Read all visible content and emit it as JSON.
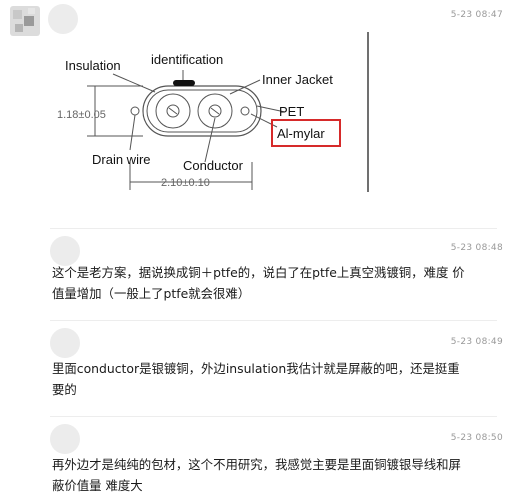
{
  "messages": [
    {
      "time": "5-23 08:47",
      "figure": {
        "labels": {
          "insulation": "Insulation",
          "identification": "identification",
          "inner_jacket": "Inner Jacket",
          "pet": "PET",
          "al_mylar": "Al-mylar",
          "drain_wire": "Drain wire",
          "conductor": "Conductor",
          "height_dim": "1.18±0.05",
          "width_dim": "2.10±0.10"
        },
        "colors": {
          "highlight": "#d62a2a",
          "line": "#555555"
        }
      }
    },
    {
      "time": "5-23 08:48",
      "text": "这个是老方案，据说换成铜＋ptfe的，说白了在ptfe上真空溅镀铜，难度 价值量增加（一般上了ptfe就会很难）"
    },
    {
      "time": "5-23 08:49",
      "text": "里面conductor是银镀铜，外边insulation我估计就是屏蔽的吧，还是挺重要的"
    },
    {
      "time": "5-23 08:50",
      "text": "再外边才是纯纯的包材，这个不用研究，我感觉主要是里面铜镀银导线和屏蔽价值量 难度大"
    }
  ]
}
